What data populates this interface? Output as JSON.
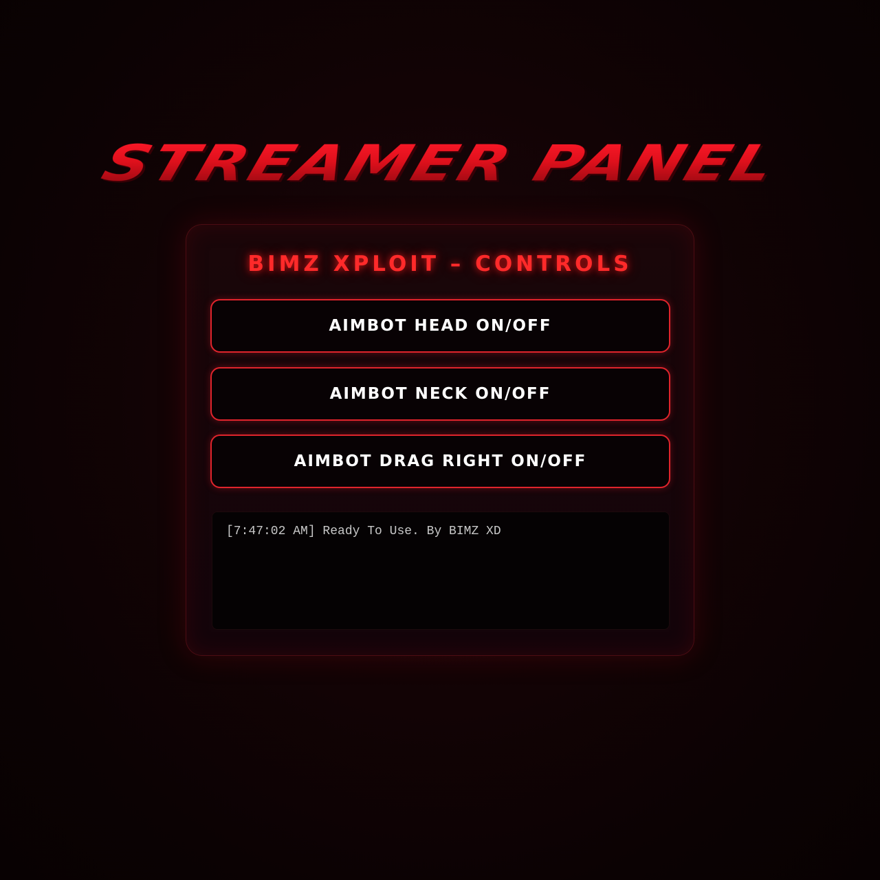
{
  "header": {
    "title": "STREAMER PANEL"
  },
  "panel": {
    "title": "BIMZ XPLOIT – CONTROLS",
    "buttons": [
      {
        "label": "AIMBOT HEAD ON/OFF"
      },
      {
        "label": "AIMBOT NECK ON/OFF"
      },
      {
        "label": "AIMBOT DRAG RIGHT ON/OFF"
      }
    ],
    "log": {
      "lines": [
        "[7:47:02 AM] Ready To Use. By BIMZ XD"
      ]
    }
  },
  "colors": {
    "accent": "#e0242c",
    "title_red": "#ff2a2a",
    "background": "#120305"
  }
}
